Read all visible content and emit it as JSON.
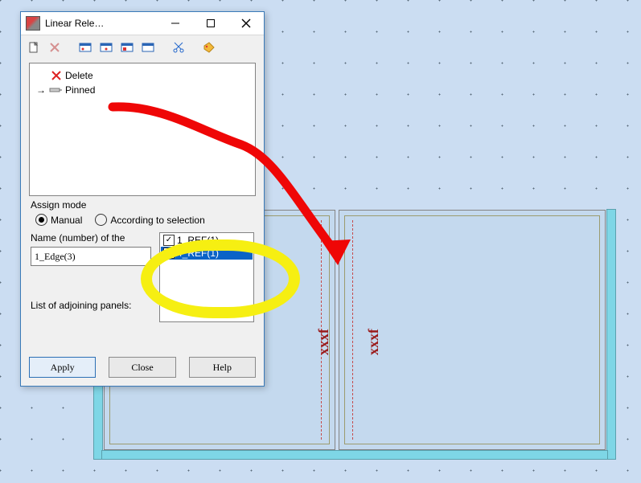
{
  "window": {
    "title": "Linear Rele…",
    "tree": {
      "delete": "Delete",
      "pinned": "Pinned"
    },
    "assign_mode_label": "Assign mode",
    "assign_manual": "Manual",
    "assign_selection": "According to selection",
    "name_label": "Name (number) of the",
    "name_value": "1_Edge(3)",
    "list_items": [
      "1_REF(1)",
      "4_REF(1)"
    ],
    "adjoining_label": "List of adjoining panels:",
    "buttons": {
      "apply": "Apply",
      "close": "Close",
      "help": "Help"
    }
  },
  "canvas": {
    "label_left": "xxxf",
    "label_right": "xxxf"
  }
}
